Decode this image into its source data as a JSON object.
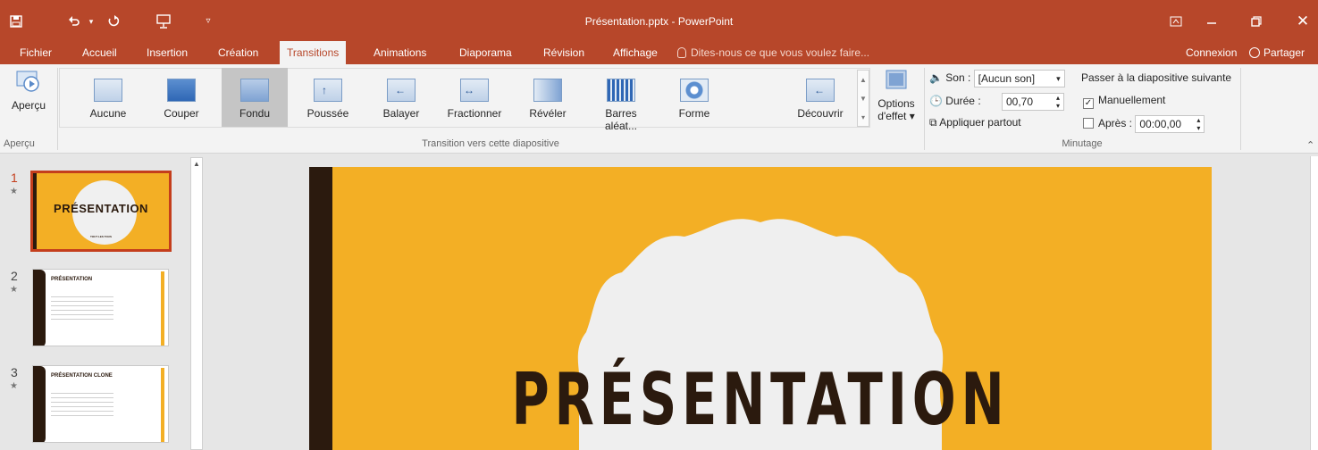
{
  "window": {
    "title": "Présentation.pptx - PowerPoint",
    "save_icon": "save-icon",
    "undo_icon": "undo-icon",
    "redo_icon": "redo-icon",
    "slideshow_icon": "start-slideshow-icon",
    "customize_icon": "customize-qat-icon"
  },
  "tabs": [
    {
      "label": "Fichier"
    },
    {
      "label": "Accueil"
    },
    {
      "label": "Insertion"
    },
    {
      "label": "Création"
    },
    {
      "label": "Transitions",
      "active": true
    },
    {
      "label": "Animations"
    },
    {
      "label": "Diaporama"
    },
    {
      "label": "Révision"
    },
    {
      "label": "Affichage"
    }
  ],
  "tell_me": "Dites-nous ce que vous voulez faire...",
  "account": {
    "signin": "Connexion",
    "share": "Partager"
  },
  "ribbon": {
    "preview": {
      "button_label": "Aperçu",
      "group_label": "Aperçu"
    },
    "transitions": {
      "group_label": "Transition vers cette diapositive",
      "items": [
        {
          "label": "Aucune"
        },
        {
          "label": "Couper"
        },
        {
          "label": "Fondu",
          "selected": true
        },
        {
          "label": "Poussée"
        },
        {
          "label": "Balayer"
        },
        {
          "label": "Fractionner"
        },
        {
          "label": "Révéler"
        },
        {
          "label": "Barres aléat..."
        },
        {
          "label": "Forme"
        },
        {
          "label": "Découvrir"
        }
      ],
      "effect_options_line1": "Options",
      "effect_options_line2": "d'effet"
    },
    "timing": {
      "group_label": "Minutage",
      "sound_label": "Son :",
      "sound_value": "[Aucun son]",
      "duration_label": "Durée :",
      "duration_value": "00,70",
      "apply_all": "Appliquer partout",
      "advance_title": "Passer à la diapositive suivante",
      "on_click_label": "Manuellement",
      "on_click_checked": true,
      "after_label": "Après :",
      "after_checked": false,
      "after_value": "00:00,00"
    }
  },
  "slides": [
    {
      "number": "1",
      "title": "PRÉSENTATION",
      "subtitle": "TOUT LES TOUS",
      "active": true
    },
    {
      "number": "2",
      "title": "PRÉSENTATION"
    },
    {
      "number": "3",
      "title": "PRÉSENTATION CLONE"
    }
  ],
  "main_slide": {
    "title": "PRÉSENTATION"
  },
  "colors": {
    "accent": "#b7472a",
    "slide_bg": "#f3af25",
    "slide_dark": "#2b1a0e"
  }
}
